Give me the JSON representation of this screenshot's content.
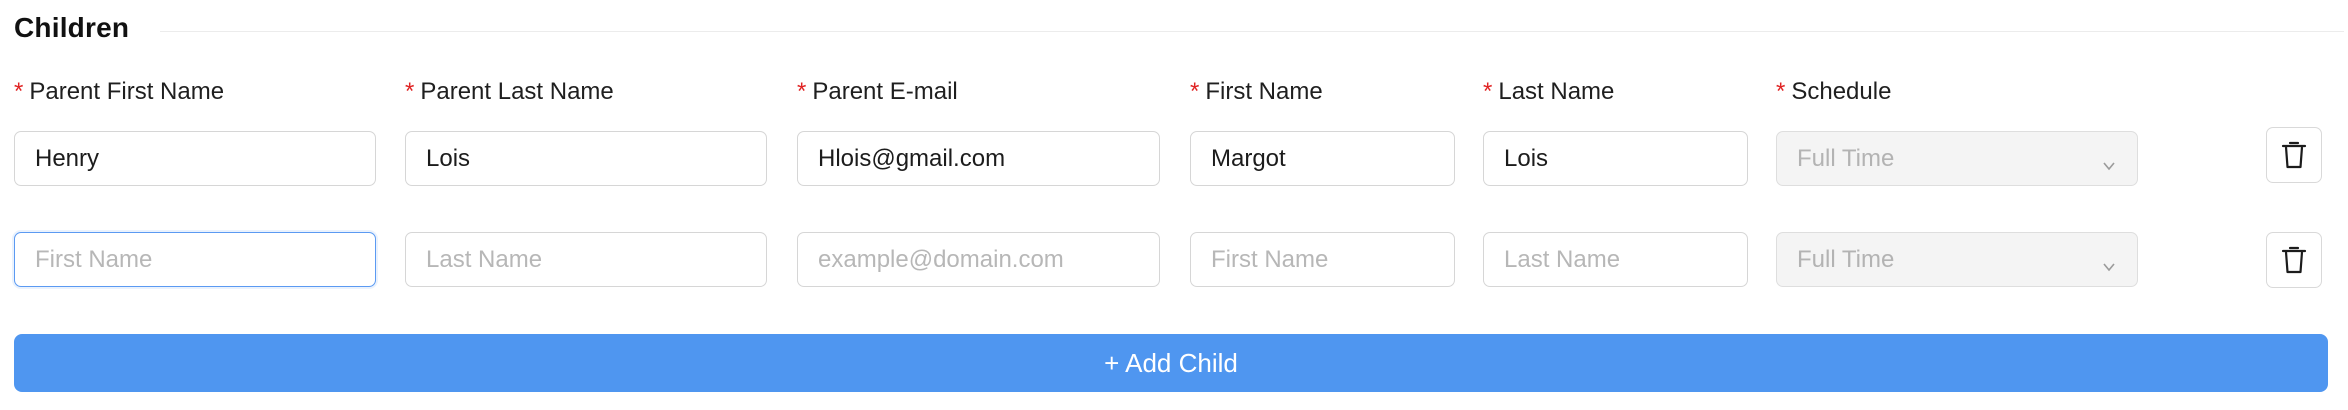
{
  "section": {
    "title": "Children"
  },
  "labels": {
    "parent_first_name": "Parent First Name",
    "parent_last_name": "Parent Last Name",
    "parent_email": "Parent E-mail",
    "first_name": "First Name",
    "last_name": "Last Name",
    "schedule": "Schedule",
    "required_marker": "*"
  },
  "rows": [
    {
      "parent_first_name": "Henry",
      "parent_last_name": "Lois",
      "parent_email": "Hlois@gmail.com",
      "first_name": "Margot",
      "last_name": "Lois",
      "schedule": "Full Time"
    },
    {
      "parent_first_name": "",
      "parent_last_name": "",
      "parent_email": "",
      "first_name": "",
      "last_name": "",
      "schedule": "Full Time"
    }
  ],
  "placeholders": {
    "parent_first_name": "First Name",
    "parent_last_name": "Last Name",
    "parent_email": "example@domain.com",
    "first_name": "First Name",
    "last_name": "Last Name"
  },
  "icons": {
    "delete": "trash-icon",
    "select": "chevron-down-icon"
  },
  "add_button": {
    "label": "+ Add Child"
  },
  "colors": {
    "required": "#e02424",
    "accent": "#4f96f0",
    "focus": "#5b9af2"
  }
}
